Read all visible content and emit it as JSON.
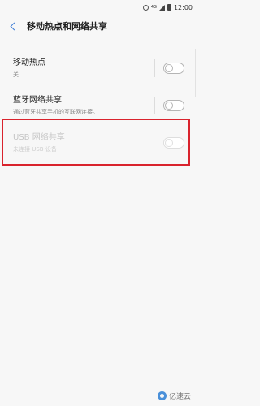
{
  "status_bar": {
    "time": "12:00",
    "net": "4G",
    "icons": [
      "settings-icon",
      "signal-icon",
      "battery-icon"
    ]
  },
  "header": {
    "back_icon": "chevron-left-icon",
    "title": "移动热点和网络共享"
  },
  "items": [
    {
      "title": "移动热点",
      "subtitle": "关",
      "toggle": "off",
      "enabled": true
    },
    {
      "title": "蓝牙网络共享",
      "subtitle": "通过蓝牙共享手机的互联网连接。",
      "toggle": "off",
      "enabled": true
    },
    {
      "title": "USB 网络共享",
      "subtitle": "未连接 USB 设备",
      "toggle": "off",
      "enabled": false
    }
  ],
  "watermark": {
    "text": "亿速云"
  },
  "colors": {
    "accent": "#3a7bd5",
    "highlight": "#d9232d"
  }
}
